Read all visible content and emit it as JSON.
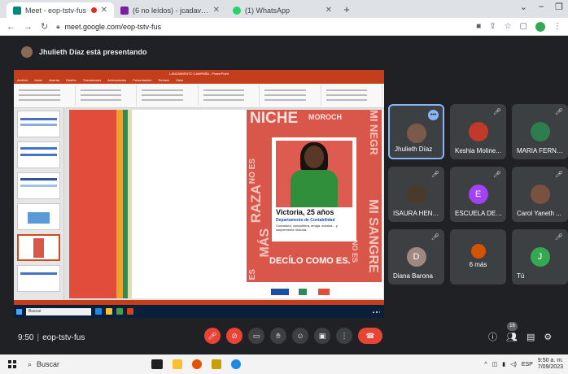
{
  "browser": {
    "tabs": [
      {
        "title": "Meet - eop-tstv-fus",
        "active": true,
        "recording": true
      },
      {
        "title": "(6 no leídos) - jcadavidmurillo@...",
        "active": false
      },
      {
        "title": "(1) WhatsApp",
        "active": false
      }
    ],
    "new_tab": "+",
    "url": "meet.google.com/eop-tstv-fus"
  },
  "presenter": {
    "text": "Jhulieth Díaz está presentando"
  },
  "shared_screen": {
    "app_title": "LANZAMIENTO CAMPAÑA - PowerPoint",
    "menu": [
      "Archivo",
      "Inicio",
      "Insertar",
      "Diseño",
      "Transiciones",
      "Animaciones",
      "Presentación",
      "Revisar",
      "Vista"
    ],
    "poster": {
      "words": {
        "niche": "NICHE",
        "moroch": "MOROCH",
        "no_es_1": "NO ES",
        "raza": "RAZA",
        "es": "ES",
        "mas": "MÁS",
        "mi_negro": "MI NEGR",
        "sangre": "MI SANGRE",
        "no_es_2": "NO ES"
      },
      "person_name": "Victoria, 25 años",
      "department": "Departamento de Contabilidad",
      "description": "Contadora, compañera, amiga, sobrina... y simplemente Victoria.",
      "slogan": "DECÍLO COMO ES."
    },
    "taskbar_search": "Buscar"
  },
  "participants": [
    {
      "name": "Jhulieth Díaz",
      "avatar": "photo",
      "color": "#7a5a4a",
      "speaking": true,
      "menu": true
    },
    {
      "name": "Keshia Moline...",
      "avatar": "photo",
      "color": "#c0392b",
      "muted": true
    },
    {
      "name": "MARIA FERNA...",
      "avatar": "photo",
      "color": "#2e7d4f",
      "muted": true
    },
    {
      "name": "ISAURA HENAO",
      "avatar": "photo",
      "color": "#4a3a2a",
      "muted": true
    },
    {
      "name": "ESCUELA DE L...",
      "avatar": "letter",
      "letter": "E",
      "color": "#a142f4",
      "muted": true
    },
    {
      "name": "Carol Yaneth ...",
      "avatar": "photo",
      "color": "#7a5040",
      "muted": true
    },
    {
      "name": "Diana Barona",
      "avatar": "letter",
      "letter": "D",
      "color": "#a1887f",
      "muted": true
    },
    {
      "name": "6 más",
      "avatar": "group",
      "color": "#d35400"
    },
    {
      "name": "Tú",
      "avatar": "letter",
      "letter": "J",
      "color": "#34a853",
      "muted": true
    }
  ],
  "meeting": {
    "time": "9:50",
    "separator": "|",
    "code": "eop-tstv-fus",
    "participant_count": "16"
  },
  "taskbar": {
    "search": "Buscar",
    "lang": "ESP",
    "time": "9:50 a. m.",
    "date": "7/09/2023"
  },
  "colors": {
    "meet_bg": "#202124",
    "tile_bg": "#3c4043",
    "danger": "#ea4335",
    "ppt_accent": "#c43e1c",
    "poster_red": "#d9574a"
  }
}
